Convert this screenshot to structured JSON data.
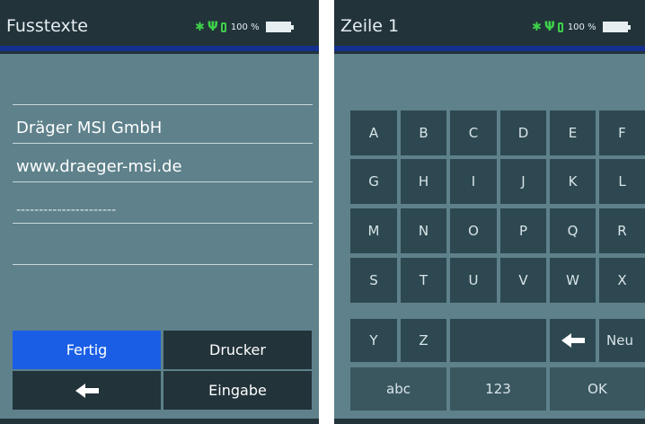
{
  "left_screen": {
    "title": "Fusstexte",
    "battery_percent": "100 %",
    "lines": [
      "",
      "Dräger MSI GmbH",
      "www.draeger-msi.de",
      "----------------------",
      "",
      ""
    ],
    "buttons": {
      "done": "Fertig",
      "printer": "Drucker",
      "back_icon": "left-arrow-icon",
      "input": "Eingabe"
    }
  },
  "right_screen": {
    "title": "Zeile 1",
    "battery_percent": "100 %",
    "keys_row1": [
      "A",
      "B",
      "C",
      "D",
      "E",
      "F"
    ],
    "keys_row2": [
      "G",
      "H",
      "I",
      "J",
      "K",
      "L"
    ],
    "keys_row3": [
      "M",
      "N",
      "O",
      "P",
      "Q",
      "R"
    ],
    "keys_row4": [
      "S",
      "T",
      "U",
      "V",
      "W",
      "X"
    ],
    "keys_row5": [
      "Y",
      "Z"
    ],
    "new_key": "Neu",
    "backspace_icon": "left-arrow-icon",
    "mode_abc": "abc",
    "mode_123": "123",
    "ok": "OK"
  },
  "colors": {
    "header": "#22333a",
    "background": "#5e818b",
    "accent": "#14308e",
    "active_button": "#1a5ee6",
    "status_green": "#3ed04a"
  }
}
